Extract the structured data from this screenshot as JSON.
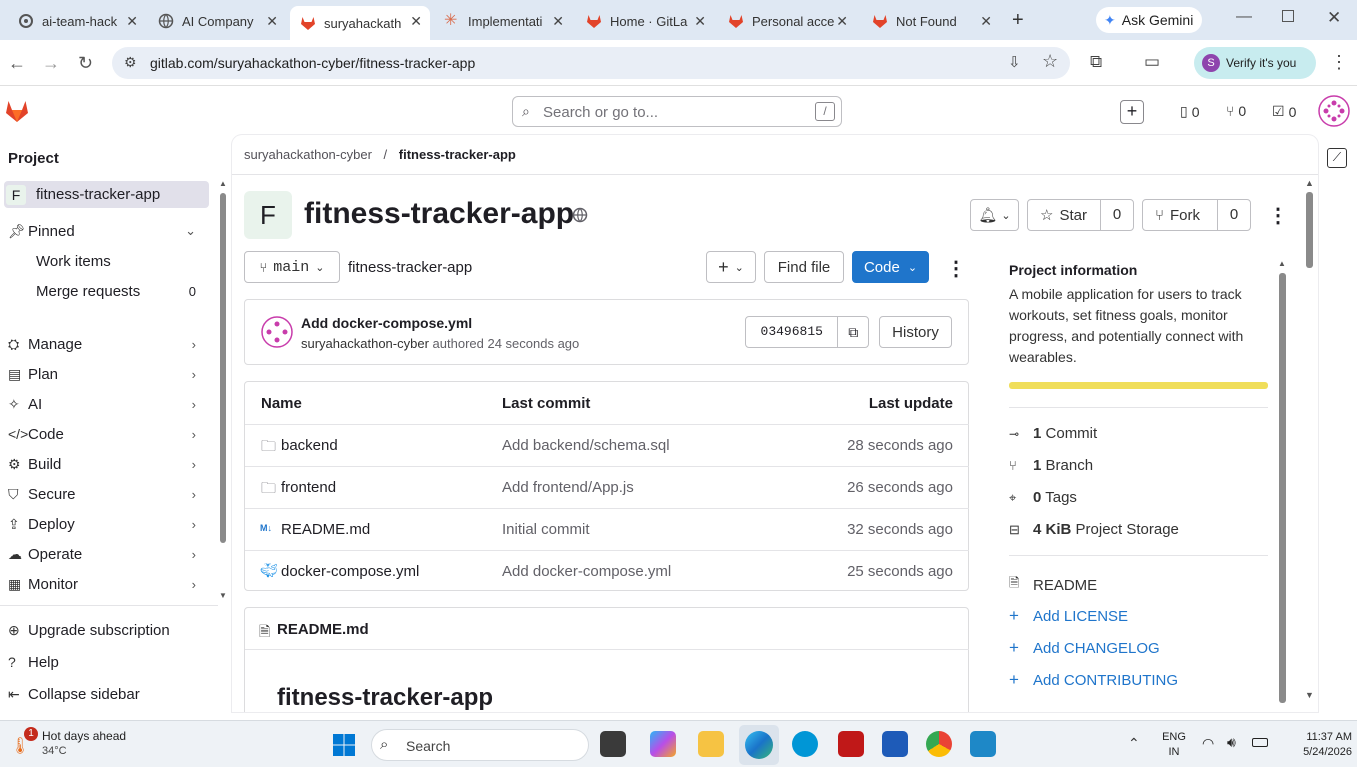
{
  "browser": {
    "tabs": [
      {
        "label": "ai-team-hack",
        "active": false
      },
      {
        "label": "AI Company",
        "active": false
      },
      {
        "label": "suryahackath",
        "active": true
      },
      {
        "label": "Implementati",
        "active": false
      },
      {
        "label": "Home · GitLa",
        "active": false
      },
      {
        "label": "Personal acce",
        "active": false
      },
      {
        "label": "Not Found",
        "active": false
      }
    ],
    "ask_gemini": "Ask Gemini",
    "url": "gitlab.com/suryahackathon-cyber/fitness-tracker-app",
    "verify_label": "Verify it's you",
    "profile_initial": "S"
  },
  "topbar": {
    "search_placeholder": "Search or go to...",
    "search_shortcut": "/",
    "issues_count": "0",
    "mr_count": "0",
    "todo_count": "0"
  },
  "sidebar": {
    "heading": "Project",
    "project_initial": "F",
    "project_name": "fitness-tracker-app",
    "pinned": "Pinned",
    "pinned_items": [
      {
        "label": "Work items",
        "count": ""
      },
      {
        "label": "Merge requests",
        "count": "0"
      }
    ],
    "sections": [
      "Manage",
      "Plan",
      "AI",
      "Code",
      "Build",
      "Secure",
      "Deploy",
      "Operate",
      "Monitor"
    ],
    "footer": [
      "Upgrade subscription",
      "Help",
      "Collapse sidebar"
    ]
  },
  "breadcrumb": {
    "group": "suryahackathon-cyber",
    "separator": "/",
    "project": "fitness-tracker-app"
  },
  "project": {
    "initial": "F",
    "title": "fitness-tracker-app",
    "star_label": "Star",
    "star_count": "0",
    "fork_label": "Fork",
    "fork_count": "0",
    "branch": "main",
    "path": "fitness-tracker-app",
    "find_file": "Find file",
    "code_button": "Code"
  },
  "last_commit": {
    "message": "Add docker-compose.yml",
    "author": "suryahackathon-cyber",
    "authored_text": "authored 24 seconds ago",
    "sha": "03496815",
    "history": "History"
  },
  "file_table": {
    "headers": [
      "Name",
      "Last commit",
      "Last update"
    ],
    "rows": [
      {
        "icon": "folder-icon",
        "name": "backend",
        "commit": "Add backend/schema.sql",
        "updated": "28 seconds ago"
      },
      {
        "icon": "folder-icon",
        "name": "frontend",
        "commit": "Add frontend/App.js",
        "updated": "26 seconds ago"
      },
      {
        "icon": "markdown-icon",
        "name": "README.md",
        "commit": "Initial commit",
        "updated": "32 seconds ago"
      },
      {
        "icon": "docker-icon",
        "name": "docker-compose.yml",
        "commit": "Add docker-compose.yml",
        "updated": "25 seconds ago"
      }
    ]
  },
  "readme": {
    "filename": "README.md",
    "heading": "fitness-tracker-app"
  },
  "project_info": {
    "title": "Project information",
    "description": "A mobile application for users to track workouts, set fitness goals, monitor progress, and potentially connect with wearables.",
    "language_bar_color": "#f0de5a",
    "stats": [
      {
        "icon": "commit-icon",
        "bold": "1",
        "label": "Commit"
      },
      {
        "icon": "branch-icon",
        "bold": "1",
        "label": "Branch"
      },
      {
        "icon": "tag-icon",
        "bold": "0",
        "label": "Tags"
      },
      {
        "icon": "storage-icon",
        "bold": "4 KiB",
        "label": "Project Storage"
      }
    ],
    "links": [
      {
        "icon": "file-icon",
        "label": "README",
        "link": false
      },
      {
        "icon": "plus-icon",
        "label": "Add LICENSE",
        "link": true
      },
      {
        "icon": "plus-icon",
        "label": "Add CHANGELOG",
        "link": true
      },
      {
        "icon": "plus-icon",
        "label": "Add CONTRIBUTING",
        "link": true
      }
    ]
  },
  "taskbar": {
    "weather_title": "Hot days ahead",
    "weather_temp": "34°C",
    "notification_badge": "1",
    "search_label": "Search",
    "lang_line1": "ENG",
    "lang_line2": "IN",
    "time": "11:37 AM",
    "date": "5/24/2026"
  }
}
